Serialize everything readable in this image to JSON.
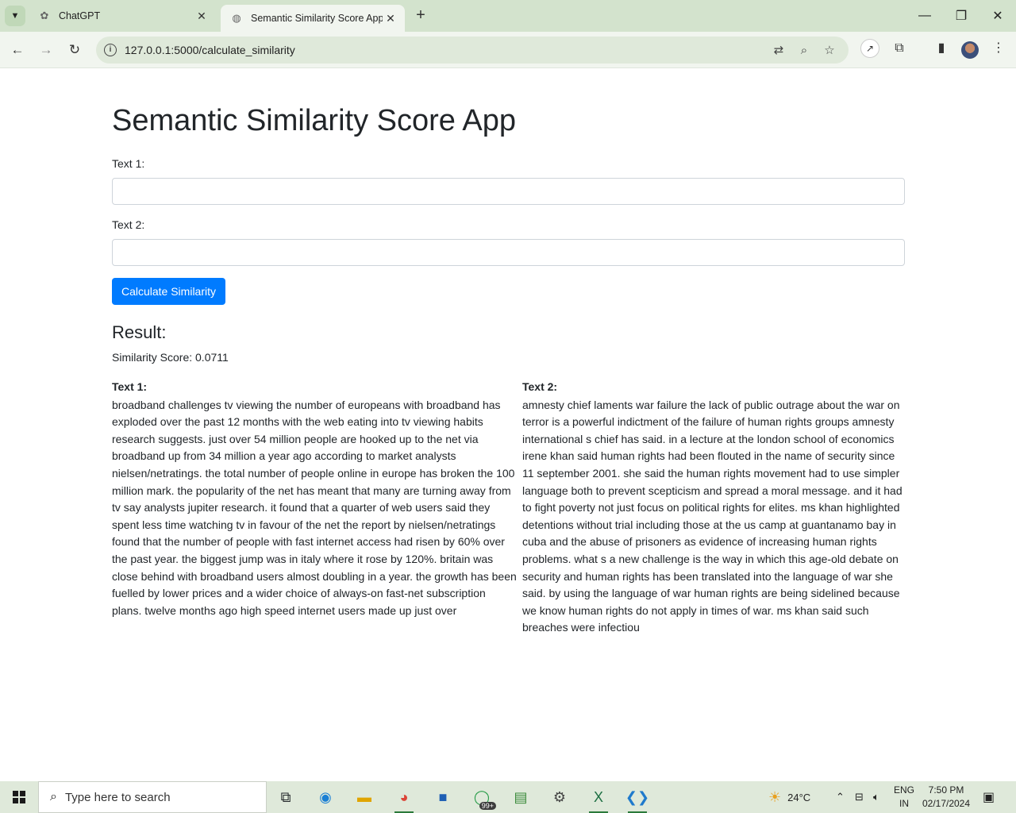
{
  "browser": {
    "tabs": [
      {
        "title": "ChatGPT",
        "favicon": "openai-icon"
      },
      {
        "title": "Semantic Similarity Score App",
        "favicon": "globe-icon"
      }
    ],
    "url": "127.0.0.1:5000/calculate_similarity"
  },
  "page": {
    "title": "Semantic Similarity Score App",
    "text1_label": "Text 1:",
    "text2_label": "Text 2:",
    "text1_value": "",
    "text2_value": "",
    "button_label": "Calculate Similarity",
    "result_heading": "Result:",
    "score_text": "Similarity Score: 0.0711",
    "col1_title": "Text 1:",
    "col1_body": "broadband challenges tv viewing the number of europeans with broadband has exploded over the past 12 months with the web eating into tv viewing habits research suggests. just over 54 million people are hooked up to the net via broadband up from 34 million a year ago according to market analysts nielsen/netratings. the total number of people online in europe has broken the 100 million mark. the popularity of the net has meant that many are turning away from tv say analysts jupiter research. it found that a quarter of web users said they spent less time watching tv in favour of the net the report by nielsen/netratings found that the number of people with fast internet access had risen by 60% over the past year. the biggest jump was in italy where it rose by 120%. britain was close behind with broadband users almost doubling in a year. the growth has been fuelled by lower prices and a wider choice of always-on fast-net subscription plans. twelve months ago high speed internet users made up just over",
    "col2_title": "Text 2:",
    "col2_body": "amnesty chief laments war failure the lack of public outrage about the war on terror is a powerful indictment of the failure of human rights groups amnesty international s chief has said. in a lecture at the london school of economics irene khan said human rights had been flouted in the name of security since 11 september 2001. she said the human rights movement had to use simpler language both to prevent scepticism and spread a moral message. and it had to fight poverty not just focus on political rights for elites. ms khan highlighted detentions without trial including those at the us camp at guantanamo bay in cuba and the abuse of prisoners as evidence of increasing human rights problems. what s a new challenge is the way in which this age-old debate on security and human rights has been translated into the language of war she said. by using the language of war human rights are being sidelined because we know human rights do not apply in times of war. ms khan said such breaches were infectiou"
  },
  "taskbar": {
    "search_placeholder": "Type here to search",
    "weather": "24°C",
    "lang_top": "ENG",
    "lang_bottom": "IN",
    "time": "7:50 PM",
    "date": "02/17/2024",
    "whatsapp_badge": "99+"
  },
  "colors": {
    "accent_button": "#007bff",
    "chrome_bg": "#d3e3cd"
  }
}
